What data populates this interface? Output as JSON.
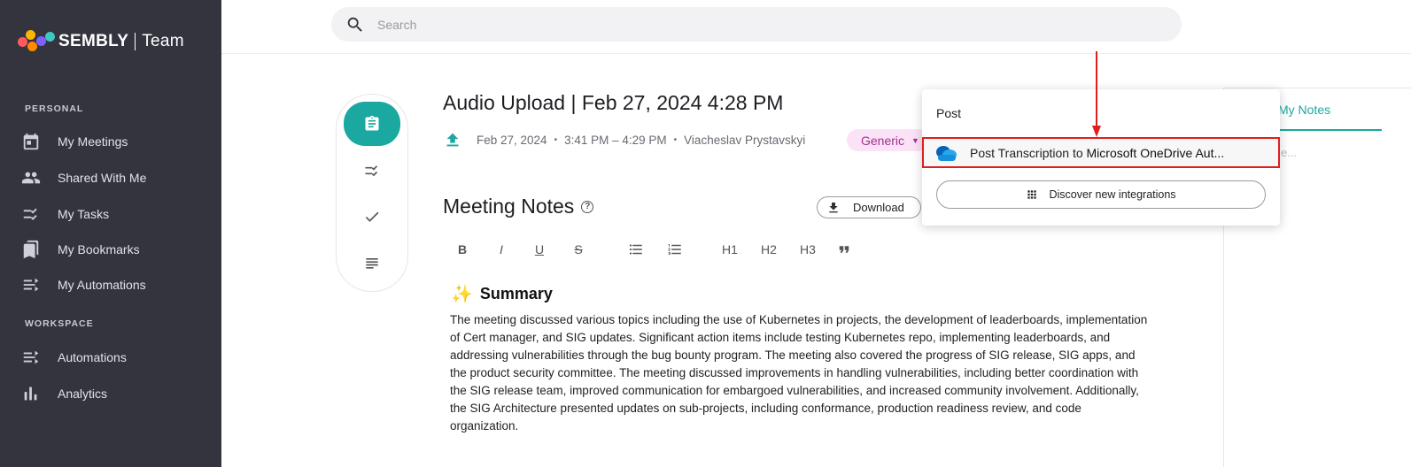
{
  "sidebar": {
    "brand": "SEMBLY",
    "brand_suffix": "Team",
    "personal_label": "PERSONAL",
    "personal_items": [
      {
        "label": "My Meetings",
        "icon": "calendar-icon"
      },
      {
        "label": "Shared With Me",
        "icon": "people-icon"
      },
      {
        "label": "My Tasks",
        "icon": "tasks-icon"
      },
      {
        "label": "My Bookmarks",
        "icon": "bookmark-icon"
      },
      {
        "label": "My Automations",
        "icon": "automation-icon"
      }
    ],
    "workspace_label": "WORKSPACE",
    "workspace_items": [
      {
        "label": "Automations",
        "icon": "automation-icon"
      },
      {
        "label": "Analytics",
        "icon": "bar-chart-icon"
      }
    ]
  },
  "search": {
    "placeholder": "Search"
  },
  "meeting": {
    "title": "Audio Upload | Feb 27, 2024 4:28 PM",
    "date": "Feb 27, 2024",
    "time": "3:41 PM – 4:29 PM",
    "owner": "Viacheslav Prystavskyi",
    "tag": "Generic"
  },
  "notes": {
    "title": "Meeting Notes",
    "download_label": "Download",
    "toolbar": [
      "B",
      "I",
      "U",
      "S",
      "bullets",
      "numbered",
      "H1",
      "H2",
      "H3",
      "quote"
    ],
    "summary_title": "Summary",
    "summary_text": "The meeting discussed various topics including the use of Kubernetes in projects, the development of leaderboards, implementation of Cert manager, and SIG updates. Significant action items include testing Kubernetes repo, implementing leaderboards, and addressing vulnerabilities through the bug bounty program. The meeting also covered the progress of SIG release, SIG apps, and the product security committee. The meeting discussed improvements in handling vulnerabilities, including better coordination with the SIG release team, improved communication for embargoed vulnerabilities, and increased community involvement. Additionally, the SIG Architecture presented updates on sub-projects, including conformance, production readiness review, and code organization."
  },
  "right_panel": {
    "tab": "My Notes",
    "faded": "e..."
  },
  "popup": {
    "header": "Post",
    "item_prefix": "Post Transcription to",
    "item_target": "Microsoft OneDrive Aut...",
    "discover_label": "Discover new integrations"
  },
  "colors": {
    "accent": "#1aa8a0",
    "sidebar": "#34343f",
    "highlight": "#e01e1e",
    "tag_bg": "#fbe2f6"
  }
}
